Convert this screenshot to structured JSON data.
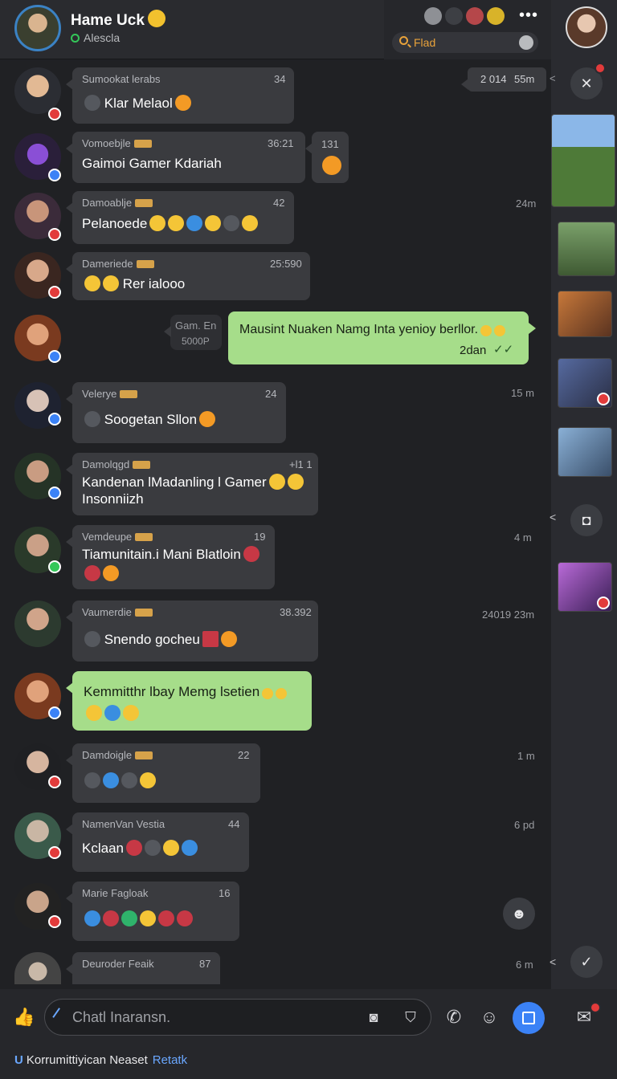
{
  "header": {
    "title": "Hame Uck",
    "status": "Alescla",
    "search_placeholder": "Flad",
    "more": "•••"
  },
  "top_right_bubble": {
    "left": "2 014",
    "right": "55m"
  },
  "messages": [
    {
      "sender": "Sumookat lerabs",
      "count": "34",
      "text": "Klar Melaol",
      "time": ""
    },
    {
      "sender": "Vomoebjle",
      "count": "36:21",
      "text": "Gaimoi Gamer Kdariah",
      "side_count": "131",
      "time": ""
    },
    {
      "sender": "Damoablje",
      "count": "42",
      "text": "Pelanoede",
      "time": "24m"
    },
    {
      "sender": "Dameriede",
      "count": "25:590",
      "text": "Rer ialooo",
      "time": ""
    },
    {
      "sender": "",
      "count": "",
      "text": "Mausint Nuaken Namg Inta yenioy berllor.",
      "meta": "2dan",
      "side_top": "Gam. En",
      "side_bottom": "5000P"
    },
    {
      "sender": "Velerye",
      "count": "24",
      "text": "Soogetan Sllon",
      "time": "15 m"
    },
    {
      "sender": "Damolqgd",
      "count": "+l1 1",
      "text": "Kandenan lMadanling l Gamer",
      "text2": "Insonniizh",
      "time": ""
    },
    {
      "sender": "Vemdeupe",
      "count": "19",
      "text": "Tiamunitain.i Mani Blatloin",
      "time": "4 m"
    },
    {
      "sender": "Vaumerdie",
      "count": "38.392",
      "text": "Snendo gocheu",
      "time": "24019  23m"
    },
    {
      "sender": "",
      "count": "",
      "text": "Kemmitthr lbay Memg lsetien",
      "time": ""
    },
    {
      "sender": "Damdoigle",
      "count": "22",
      "text": "",
      "time": "1 m"
    },
    {
      "sender": "NamenVan Vestia",
      "count": "44",
      "text": "Kclaan",
      "time": "6 pd"
    },
    {
      "sender": "Marie Fagloak",
      "count": "16",
      "text": "",
      "time": ""
    },
    {
      "sender": "Deuroder Feaik",
      "count": "87",
      "text": "",
      "time": "6 m"
    }
  ],
  "composer": {
    "placeholder": "Chatl Inaransn.",
    "footer_prefix": "U",
    "footer_text": "Korrumittiyican Neaset",
    "footer_link": "Retatk"
  },
  "colors": {
    "accent": "#3b82f6",
    "outgoing_bubble": "#a6dd8a",
    "incoming_bubble": "#3a3b3f",
    "background": "#202124"
  }
}
